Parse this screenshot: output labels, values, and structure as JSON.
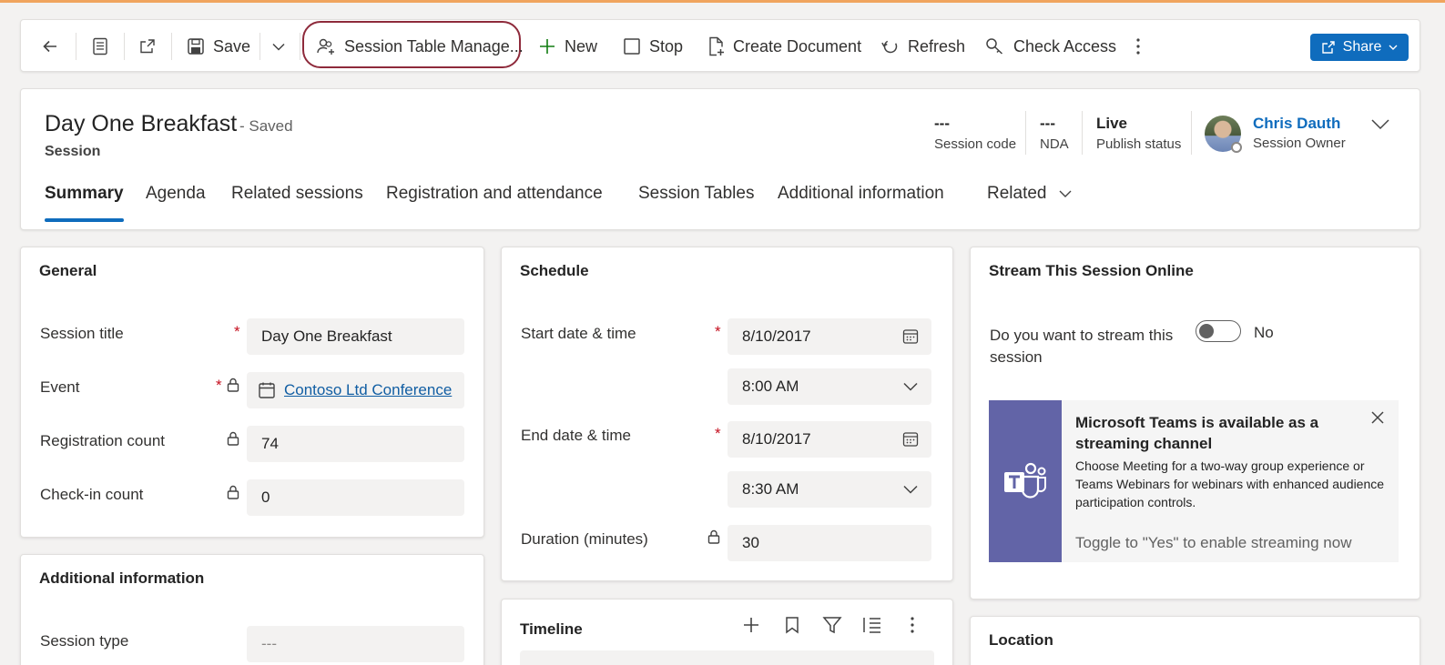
{
  "colors": {
    "brand": "#0f6cbd",
    "highlight_ring": "#8e2a3b",
    "required": "#c50f1f",
    "teams": "#6264a7",
    "new_plus": "#107c10"
  },
  "commandbar": {
    "save_label": "Save",
    "session_table_label": "Session Table Manage...",
    "new_label": "New",
    "stop_label": "Stop",
    "create_document_label": "Create Document",
    "refresh_label": "Refresh",
    "check_access_label": "Check Access",
    "share_label": "Share"
  },
  "header": {
    "title": "Day One Breakfast",
    "saved_status": "- Saved",
    "entity": "Session",
    "fields": [
      {
        "value": "---",
        "label": "Session code"
      },
      {
        "value": "---",
        "label": "NDA"
      },
      {
        "value": "Live",
        "label": "Publish status"
      }
    ],
    "owner": {
      "name": "Chris Dauth",
      "role": "Session Owner"
    }
  },
  "tabs": [
    "Summary",
    "Agenda",
    "Related sessions",
    "Registration and attendance",
    "Session Tables",
    "Additional information",
    "Related"
  ],
  "general": {
    "title": "General",
    "session_title_label": "Session title",
    "session_title_value": "Day One Breakfast",
    "event_label": "Event",
    "event_value": "Contoso Ltd Conference",
    "registration_count_label": "Registration count",
    "registration_count_value": "74",
    "checkin_count_label": "Check-in count",
    "checkin_count_value": "0"
  },
  "additional": {
    "title": "Additional information",
    "session_type_label": "Session type",
    "session_type_value": "---"
  },
  "schedule": {
    "title": "Schedule",
    "start_label": "Start date & time",
    "start_date": "8/10/2017",
    "start_time": "8:00 AM",
    "end_label": "End date & time",
    "end_date": "8/10/2017",
    "end_time": "8:30 AM",
    "duration_label": "Duration (minutes)",
    "duration_value": "30"
  },
  "timeline": {
    "title": "Timeline"
  },
  "stream": {
    "title": "Stream This Session Online",
    "question_line1": "Do you want to stream this",
    "question_line2": "session",
    "toggle_value": "No",
    "banner_title": "Microsoft Teams is available as a streaming channel",
    "banner_body": "Choose Meeting for a two-way group experience or Teams Webinars for webinars with enhanced audience participation controls.",
    "banner_footer": "Toggle to \"Yes\" to enable streaming now"
  },
  "location": {
    "title": "Location"
  }
}
